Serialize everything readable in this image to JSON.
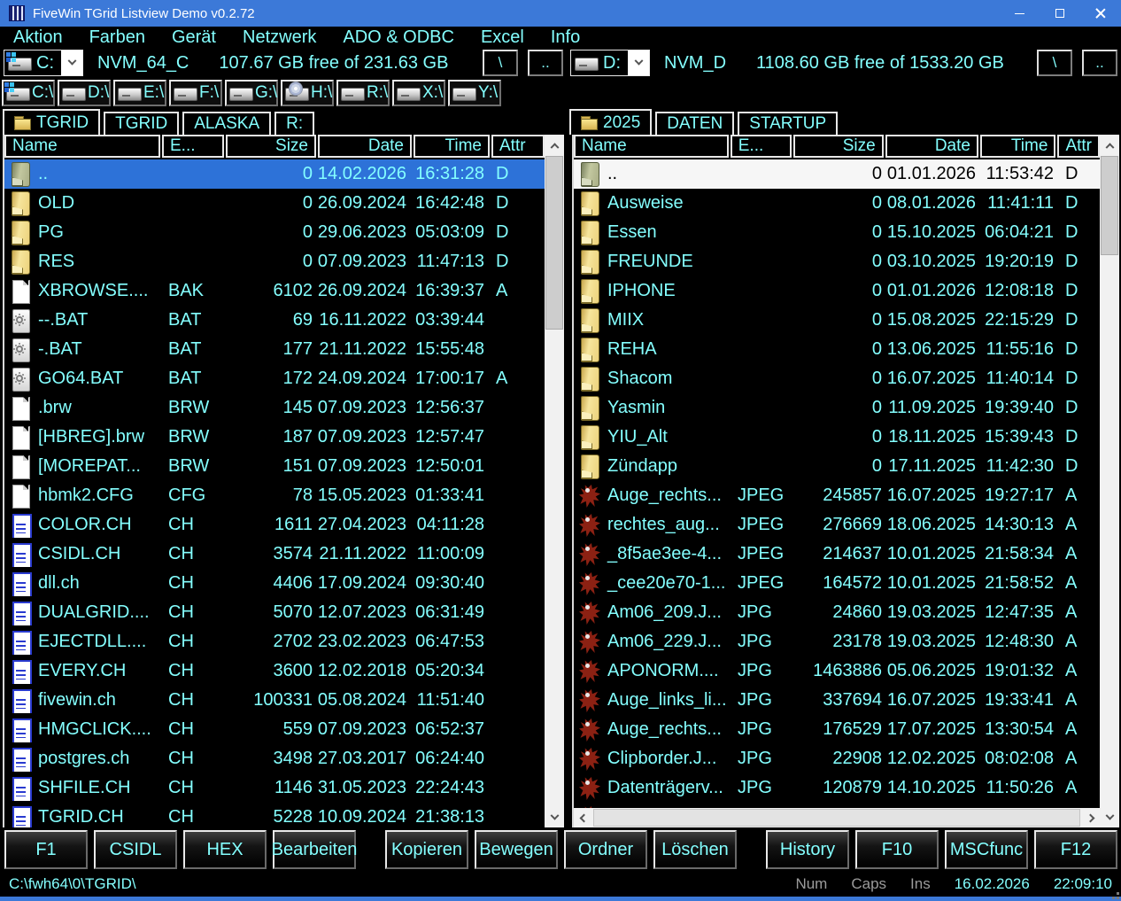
{
  "window": {
    "title": "FiveWin TGrid Listview Demo v0.2.72"
  },
  "menu": {
    "items": [
      "Aktion",
      "Farben",
      "Gerät",
      "Netzwerk",
      "ADO & ODBC",
      "Excel",
      "Info"
    ]
  },
  "drive_bars": {
    "left": {
      "drive": "C:",
      "icon": "system-drive",
      "volume": "NVM_64_C",
      "free": "107.67 GB free of 231.63 GB",
      "root_button": "\\",
      "up_button": ".."
    },
    "right": {
      "drive": "D:",
      "icon": "drive",
      "volume": "NVM_D",
      "free": "1108.60 GB free of 1533.20 GB",
      "root_button": "\\",
      "up_button": ".."
    }
  },
  "drive_buttons": [
    {
      "label": "C:\\",
      "icon": "system-drive"
    },
    {
      "label": "D:\\",
      "icon": "drive"
    },
    {
      "label": "E:\\",
      "icon": "drive"
    },
    {
      "label": "F:\\",
      "icon": "drive"
    },
    {
      "label": "G:\\",
      "icon": "drive"
    },
    {
      "label": "H:\\",
      "icon": "cd-drive"
    },
    {
      "label": "R:\\",
      "icon": "drive"
    },
    {
      "label": "X:\\",
      "icon": "drive"
    },
    {
      "label": "Y:\\",
      "icon": "drive"
    }
  ],
  "tabs": {
    "left": [
      {
        "label": "TGRID",
        "active": true
      },
      {
        "label": "TGRID"
      },
      {
        "label": "ALASKA"
      },
      {
        "label": "R:"
      }
    ],
    "right": [
      {
        "label": "2025",
        "active": true
      },
      {
        "label": "DATEN"
      },
      {
        "label": "STARTUP"
      }
    ]
  },
  "columns": [
    "Name",
    "E...",
    "Size",
    "Date",
    "Time",
    "Attr"
  ],
  "panels": {
    "left": {
      "rows": [
        {
          "icon": "folder-up",
          "name": "..",
          "ext": "",
          "size": "0",
          "date": "14.02.2026",
          "time": "16:31:28",
          "attr": "D",
          "sel": "active"
        },
        {
          "icon": "folder",
          "name": "OLD",
          "ext": "",
          "size": "0",
          "date": "26.09.2024",
          "time": "16:42:48",
          "attr": "D"
        },
        {
          "icon": "folder",
          "name": "PG",
          "ext": "",
          "size": "0",
          "date": "29.06.2023",
          "time": "05:03:09",
          "attr": "D"
        },
        {
          "icon": "folder",
          "name": "RES",
          "ext": "",
          "size": "0",
          "date": "07.09.2023",
          "time": "11:47:13",
          "attr": "D"
        },
        {
          "icon": "file",
          "name": "XBROWSE....",
          "ext": "BAK",
          "size": "6102",
          "date": "26.09.2024",
          "time": "16:39:37",
          "attr": "A"
        },
        {
          "icon": "gear",
          "name": "--.BAT",
          "ext": "BAT",
          "size": "69",
          "date": "16.11.2022",
          "time": "03:39:44",
          "attr": ""
        },
        {
          "icon": "gear",
          "name": "-.BAT",
          "ext": "BAT",
          "size": "177",
          "date": "21.11.2022",
          "time": "15:55:48",
          "attr": ""
        },
        {
          "icon": "gear",
          "name": "GO64.BAT",
          "ext": "BAT",
          "size": "172",
          "date": "24.09.2024",
          "time": "17:00:17",
          "attr": "A"
        },
        {
          "icon": "file",
          "name": ".brw",
          "ext": "BRW",
          "size": "145",
          "date": "07.09.2023",
          "time": "12:56:37",
          "attr": ""
        },
        {
          "icon": "file",
          "name": "[HBREG].brw",
          "ext": "BRW",
          "size": "187",
          "date": "07.09.2023",
          "time": "12:57:47",
          "attr": ""
        },
        {
          "icon": "file",
          "name": "[MOREPAT...",
          "ext": "BRW",
          "size": "151",
          "date": "07.09.2023",
          "time": "12:50:01",
          "attr": ""
        },
        {
          "icon": "file",
          "name": "hbmk2.CFG",
          "ext": "CFG",
          "size": "78",
          "date": "15.05.2023",
          "time": "01:33:41",
          "attr": ""
        },
        {
          "icon": "ch",
          "name": "COLOR.CH",
          "ext": "CH",
          "size": "1611",
          "date": "27.04.2023",
          "time": "04:11:28",
          "attr": ""
        },
        {
          "icon": "ch",
          "name": "CSIDL.CH",
          "ext": "CH",
          "size": "3574",
          "date": "21.11.2022",
          "time": "11:00:09",
          "attr": ""
        },
        {
          "icon": "ch",
          "name": "dll.ch",
          "ext": "CH",
          "size": "4406",
          "date": "17.09.2024",
          "time": "09:30:40",
          "attr": ""
        },
        {
          "icon": "ch",
          "name": "DUALGRID....",
          "ext": "CH",
          "size": "5070",
          "date": "12.07.2023",
          "time": "06:31:49",
          "attr": ""
        },
        {
          "icon": "ch",
          "name": "EJECTDLL....",
          "ext": "CH",
          "size": "2702",
          "date": "23.02.2023",
          "time": "06:47:53",
          "attr": ""
        },
        {
          "icon": "ch",
          "name": "EVERY.CH",
          "ext": "CH",
          "size": "3600",
          "date": "12.02.2018",
          "time": "05:20:34",
          "attr": ""
        },
        {
          "icon": "ch",
          "name": "fivewin.ch",
          "ext": "CH",
          "size": "100331",
          "date": "05.08.2024",
          "time": "11:51:40",
          "attr": ""
        },
        {
          "icon": "ch",
          "name": "HMGCLICK....",
          "ext": "CH",
          "size": "559",
          "date": "07.09.2023",
          "time": "06:52:37",
          "attr": ""
        },
        {
          "icon": "ch",
          "name": "postgres.ch",
          "ext": "CH",
          "size": "3498",
          "date": "27.03.2017",
          "time": "06:24:40",
          "attr": ""
        },
        {
          "icon": "ch",
          "name": "SHFILE.CH",
          "ext": "CH",
          "size": "1146",
          "date": "31.05.2023",
          "time": "22:24:43",
          "attr": ""
        },
        {
          "icon": "ch",
          "name": "TGRID.CH",
          "ext": "CH",
          "size": "5228",
          "date": "10.09.2024",
          "time": "21:38:13",
          "attr": ""
        }
      ]
    },
    "right": {
      "rows": [
        {
          "icon": "folder-up",
          "name": "..",
          "ext": "",
          "size": "0",
          "date": "01.01.2026",
          "time": "11:53:42",
          "attr": "D",
          "sel": "inactive"
        },
        {
          "icon": "folder",
          "name": "Ausweise",
          "ext": "",
          "size": "0",
          "date": "08.01.2026",
          "time": "11:41:11",
          "attr": "D"
        },
        {
          "icon": "folder",
          "name": "Essen",
          "ext": "",
          "size": "0",
          "date": "15.10.2025",
          "time": "06:04:21",
          "attr": "D"
        },
        {
          "icon": "folder",
          "name": "FREUNDE",
          "ext": "",
          "size": "0",
          "date": "03.10.2025",
          "time": "19:20:19",
          "attr": "D"
        },
        {
          "icon": "folder",
          "name": "IPHONE",
          "ext": "",
          "size": "0",
          "date": "01.01.2026",
          "time": "12:08:18",
          "attr": "D"
        },
        {
          "icon": "folder",
          "name": "MIIX",
          "ext": "",
          "size": "0",
          "date": "15.08.2025",
          "time": "22:15:29",
          "attr": "D"
        },
        {
          "icon": "folder",
          "name": "REHA",
          "ext": "",
          "size": "0",
          "date": "13.06.2025",
          "time": "11:55:16",
          "attr": "D"
        },
        {
          "icon": "folder",
          "name": "Shacom",
          "ext": "",
          "size": "0",
          "date": "16.07.2025",
          "time": "11:40:14",
          "attr": "D"
        },
        {
          "icon": "folder",
          "name": "Yasmin",
          "ext": "",
          "size": "0",
          "date": "11.09.2025",
          "time": "19:39:40",
          "attr": "D"
        },
        {
          "icon": "folder",
          "name": "YIU_Alt",
          "ext": "",
          "size": "0",
          "date": "18.11.2025",
          "time": "15:39:43",
          "attr": "D"
        },
        {
          "icon": "folder",
          "name": "Zündapp",
          "ext": "",
          "size": "0",
          "date": "17.11.2025",
          "time": "11:42:30",
          "attr": "D"
        },
        {
          "icon": "img",
          "name": "Auge_rechts...",
          "ext": "JPEG",
          "size": "245857",
          "date": "16.07.2025",
          "time": "19:27:17",
          "attr": "A"
        },
        {
          "icon": "img",
          "name": "rechtes_aug...",
          "ext": "JPEG",
          "size": "276669",
          "date": "18.06.2025",
          "time": "14:30:13",
          "attr": "A"
        },
        {
          "icon": "img",
          "name": "_8f5ae3ee-4...",
          "ext": "JPEG",
          "size": "214637",
          "date": "10.01.2025",
          "time": "21:58:34",
          "attr": "A"
        },
        {
          "icon": "img",
          "name": "_cee20e70-1...",
          "ext": "JPEG",
          "size": "164572",
          "date": "10.01.2025",
          "time": "21:58:52",
          "attr": "A"
        },
        {
          "icon": "img",
          "name": "Am06_209.J...",
          "ext": "JPG",
          "size": "24860",
          "date": "19.03.2025",
          "time": "12:47:35",
          "attr": "A"
        },
        {
          "icon": "img",
          "name": "Am06_229.J...",
          "ext": "JPG",
          "size": "23178",
          "date": "19.03.2025",
          "time": "12:48:30",
          "attr": "A"
        },
        {
          "icon": "img",
          "name": "APONORM....",
          "ext": "JPG",
          "size": "1463886",
          "date": "05.06.2025",
          "time": "19:01:32",
          "attr": "A"
        },
        {
          "icon": "img",
          "name": "Auge_links_li...",
          "ext": "JPG",
          "size": "337694",
          "date": "16.07.2025",
          "time": "19:33:41",
          "attr": "A"
        },
        {
          "icon": "img",
          "name": "Auge_rechts...",
          "ext": "JPG",
          "size": "176529",
          "date": "17.07.2025",
          "time": "13:30:54",
          "attr": "A"
        },
        {
          "icon": "img",
          "name": "Clipborder.J...",
          "ext": "JPG",
          "size": "22908",
          "date": "12.02.2025",
          "time": "08:02:08",
          "attr": "A"
        },
        {
          "icon": "img",
          "name": "Datenträgerv...",
          "ext": "JPG",
          "size": "120879",
          "date": "14.10.2025",
          "time": "11:50:26",
          "attr": "A"
        },
        {
          "icon": "img",
          "name": "",
          "ext": "",
          "size": "",
          "date": "",
          "time": "",
          "attr": ""
        }
      ]
    }
  },
  "function_buttons": [
    [
      "F1",
      "CSIDL",
      "HEX",
      "Bearbeiten"
    ],
    [
      "Kopieren",
      "Bewegen",
      "Ordner",
      "Löschen"
    ],
    [
      "History",
      "F10",
      "MSCfunc",
      "F12"
    ]
  ],
  "status_bar": {
    "path": "C:\\fwh64\\0\\TGRID\\",
    "num": "Num",
    "caps": "Caps",
    "ins": "Ins",
    "date": "16.02.2026",
    "time": "22:09:10"
  },
  "colors": {
    "accent": "#3c79d8",
    "text": "#84ffff",
    "selection_active": "#2d72d8",
    "selection_inactive": "#f6f6f6"
  }
}
